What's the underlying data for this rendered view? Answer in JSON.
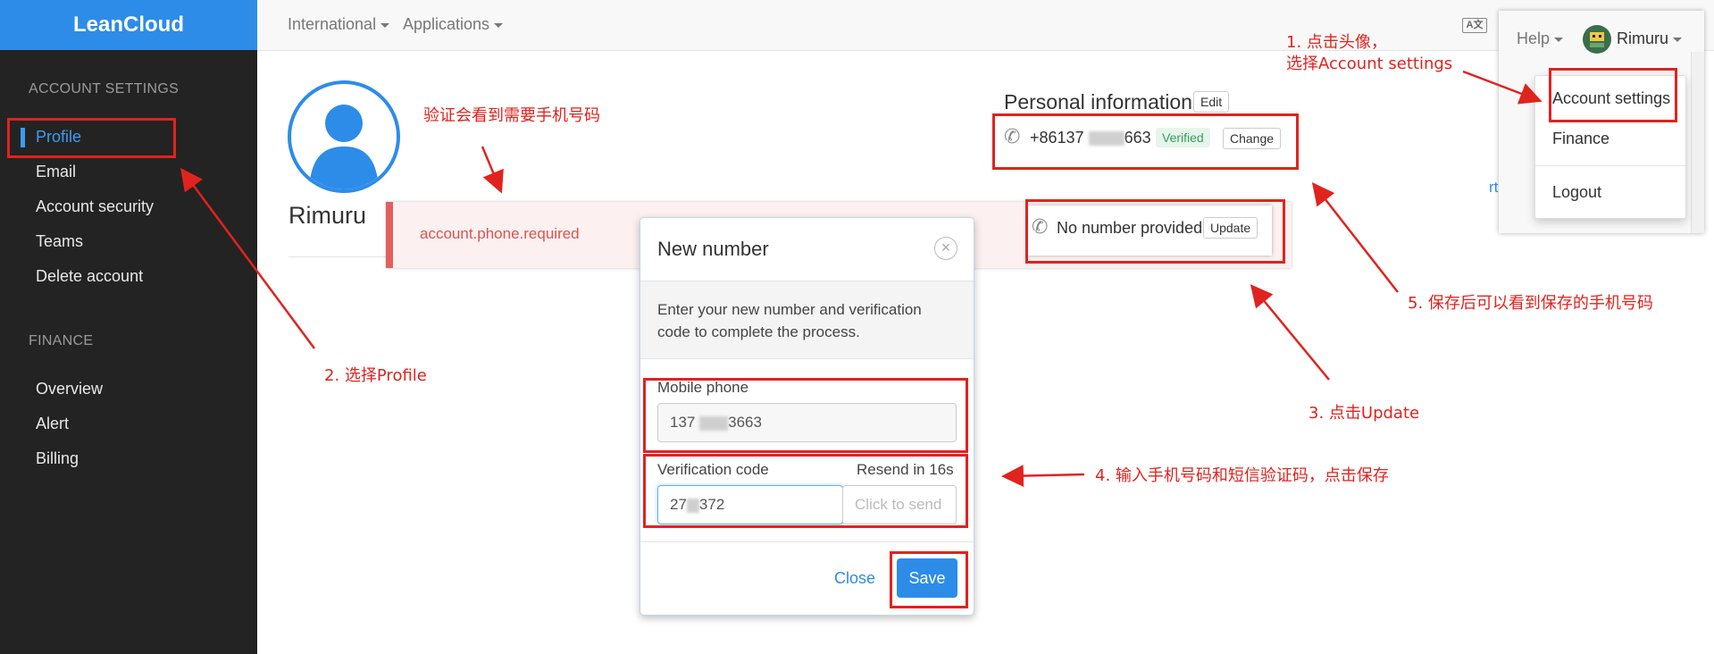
{
  "app": {
    "brand": "LeanCloud"
  },
  "sidebar": {
    "sections": [
      {
        "heading": "ACCOUNT SETTINGS",
        "items": [
          "Profile",
          "Email",
          "Account security",
          "Teams",
          "Delete account"
        ]
      },
      {
        "heading": "FINANCE",
        "items": [
          "Overview",
          "Alert",
          "Billing"
        ]
      }
    ],
    "active_item": "Profile"
  },
  "topbar": {
    "nav": [
      "International",
      "Applications"
    ],
    "help_label": "Help",
    "user_name": "Rimuru"
  },
  "user_menu": {
    "items": [
      "Account settings",
      "Finance",
      "Logout"
    ]
  },
  "profile": {
    "name": "Rimuru",
    "alert_text": "account.phone.required"
  },
  "personal_info": {
    "title": "Personal information",
    "edit_label": "Edit",
    "phone_prefix": "+86137",
    "phone_suffix": "663",
    "verified_label": "Verified",
    "change_label": "Change",
    "no_number_text": "No number provided",
    "update_label": "Update"
  },
  "modal": {
    "title": "New number",
    "close_glyph": "×",
    "description": "Enter your new number and verification code to complete the process.",
    "mobile_label": "Mobile phone",
    "mobile_prefix": "137",
    "mobile_suffix": "3663",
    "code_label": "Verification code",
    "resend_text": "Resend in 16s",
    "code_prefix": "27",
    "code_suffix": "372",
    "send_placeholder": "Click to send",
    "close_label": "Close",
    "save_label": "Save"
  },
  "annotations": {
    "step1_line1": "1. 点击头像，",
    "step1_line2": "选择Account settings",
    "step2": "2. 选择Profile",
    "step3": "3. 点击Update",
    "step4": "4. 输入手机号码和短信验证码，点击保存",
    "step5": "5. 保存后可以看到保存的手机号码",
    "note_phone": "验证会看到需要手机号码"
  },
  "colors": {
    "brand_blue": "#2d8ce8",
    "sidebar_bg": "#232323",
    "annotation_red": "#e0231e",
    "alert_red": "#d9534f",
    "verified_green": "#3c9a5f"
  }
}
